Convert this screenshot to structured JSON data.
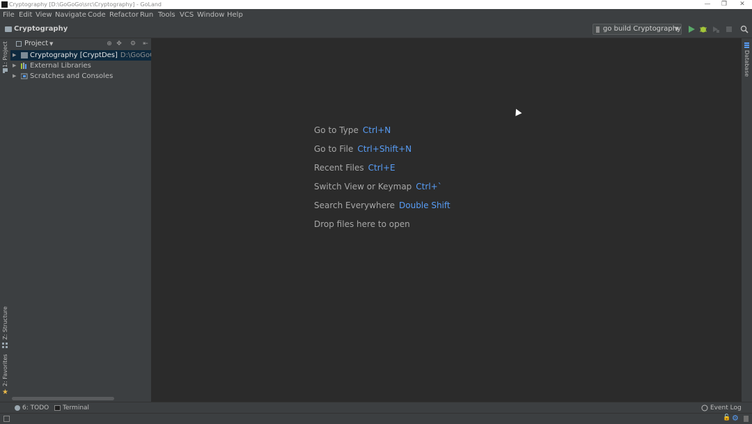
{
  "window": {
    "title": "Cryptography [D:\\GoGoGo\\src\\Cryptography] - GoLand"
  },
  "menu": [
    "File",
    "Edit",
    "View",
    "Navigate",
    "Code",
    "Refactor",
    "Run",
    "Tools",
    "VCS",
    "Window",
    "Help"
  ],
  "navbar": {
    "breadcrumb": "Cryptography",
    "run_config": "go build Cryptography"
  },
  "left_tabs": {
    "project": "1: Project",
    "structure": "Z: Structure",
    "favorites": "2: Favorites"
  },
  "right_tabs": {
    "database": "Database"
  },
  "project_panel": {
    "header": "Project",
    "tree": [
      {
        "label": "Cryptography [CryptDes]",
        "path": "D:\\GoGoGo\\s",
        "selected": true
      },
      {
        "label": "External Libraries",
        "path": "",
        "selected": false
      },
      {
        "label": "Scratches and Consoles",
        "path": "",
        "selected": false
      }
    ]
  },
  "editor_hints": [
    {
      "text": "Go to Type",
      "key": "Ctrl+N"
    },
    {
      "text": "Go to File",
      "key": "Ctrl+Shift+N"
    },
    {
      "text": "Recent Files",
      "key": "Ctrl+E"
    },
    {
      "text": "Switch View or Keymap",
      "key": "Ctrl+`"
    },
    {
      "text": "Search Everywhere",
      "key": "Double Shift"
    },
    {
      "text": "Drop files here to open",
      "key": ""
    }
  ],
  "bottom_tabs": {
    "todo": "6: TODO",
    "terminal": "Terminal",
    "event_log": "Event Log"
  },
  "colors": {
    "accent": "#589df6",
    "run_green": "#59a869",
    "debug_green": "#a4c639"
  }
}
